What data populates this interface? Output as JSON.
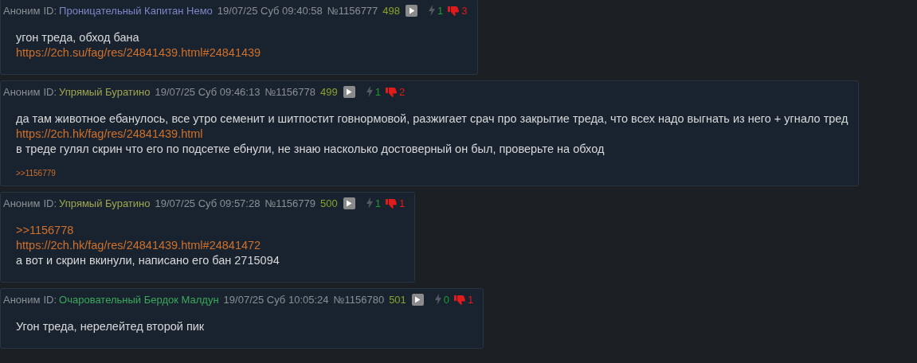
{
  "posts": [
    {
      "author": "Аноним",
      "id_label": "ID:",
      "id_name": "Проницательный Капитан Немо",
      "color": "#7e86c6",
      "datetime": "19/07/25 Суб 09:40:58",
      "number": "№1156777",
      "ordinal": "498",
      "likes": "1",
      "dislikes": "3",
      "lines": [
        {
          "kind": "text",
          "text": "угон треда, обход бана"
        },
        {
          "kind": "link",
          "text": "https://2ch.su/fag/res/24841439.html#24841439"
        }
      ]
    },
    {
      "author": "Аноним",
      "id_label": "ID:",
      "id_name": "Упрямый Буратино",
      "color": "#a0a650",
      "datetime": "19/07/25 Суб 09:46:13",
      "number": "№1156778",
      "ordinal": "499",
      "likes": "1",
      "dislikes": "2",
      "lines": [
        {
          "kind": "text",
          "text": "да там животное ебанулось, все утро семенит и шитпостит говнормовой, разжигает срач про закрытие треда, что всех надо выгнать из него + угнало тред"
        },
        {
          "kind": "link",
          "text": "https://2ch.hk/fag/res/24841439.html"
        },
        {
          "kind": "text",
          "text": "в треде гулял скрин что его по подсетке ебнули, не знаю насколько достоверный он был, проверьте на обход"
        }
      ],
      "replies": [
        ">>1156779"
      ]
    },
    {
      "author": "Аноним",
      "id_label": "ID:",
      "id_name": "Упрямый Буратино",
      "color": "#a0a650",
      "datetime": "19/07/25 Суб 09:57:28",
      "number": "№1156779",
      "ordinal": "500",
      "likes": "1",
      "dislikes": "1",
      "lines": [
        {
          "kind": "link",
          "text": ">>1156778"
        },
        {
          "kind": "link",
          "text": "https://2ch.hk/fag/res/24841439.html#24841472"
        },
        {
          "kind": "text",
          "text": "а вот и скрин вкинули, написано его бан 2715094"
        }
      ]
    },
    {
      "author": "Аноним",
      "id_label": "ID:",
      "id_name": "Очаровательный Бердок Малдун",
      "color": "#3aa85a",
      "datetime": "19/07/25 Суб 10:05:24",
      "number": "№1156780",
      "ordinal": "501",
      "likes": "0",
      "dislikes": "1",
      "lines": [
        {
          "kind": "text",
          "text": "Угон треда, нерелейтед второй пик"
        }
      ]
    }
  ]
}
